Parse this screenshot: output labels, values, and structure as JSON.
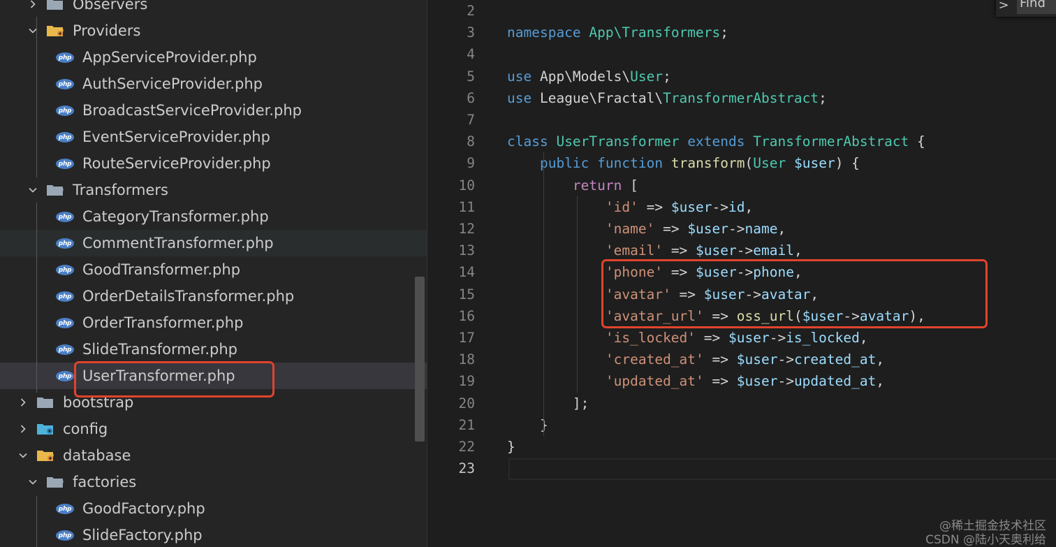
{
  "sidebar": {
    "items": [
      {
        "label": "Observers",
        "type": "folder",
        "state": "collapsed"
      },
      {
        "label": "Providers",
        "type": "folder-special",
        "state": "expanded"
      },
      {
        "label": "AppServiceProvider.php",
        "type": "php"
      },
      {
        "label": "AuthServiceProvider.php",
        "type": "php"
      },
      {
        "label": "BroadcastServiceProvider.php",
        "type": "php"
      },
      {
        "label": "EventServiceProvider.php",
        "type": "php"
      },
      {
        "label": "RouteServiceProvider.php",
        "type": "php"
      },
      {
        "label": "Transformers",
        "type": "folder",
        "state": "expanded"
      },
      {
        "label": "CategoryTransformer.php",
        "type": "php"
      },
      {
        "label": "CommentTransformer.php",
        "type": "php"
      },
      {
        "label": "GoodTransformer.php",
        "type": "php"
      },
      {
        "label": "OrderDetailsTransformer.php",
        "type": "php"
      },
      {
        "label": "OrderTransformer.php",
        "type": "php"
      },
      {
        "label": "SlideTransformer.php",
        "type": "php"
      },
      {
        "label": "UserTransformer.php",
        "type": "php",
        "selected": true
      },
      {
        "label": "bootstrap",
        "type": "folder",
        "state": "collapsed"
      },
      {
        "label": "config",
        "type": "folder-config",
        "state": "collapsed"
      },
      {
        "label": "database",
        "type": "folder-special",
        "state": "expanded"
      },
      {
        "label": "factories",
        "type": "folder",
        "state": "expanded"
      },
      {
        "label": "GoodFactory.php",
        "type": "php"
      },
      {
        "label": "SlideFactory.php",
        "type": "php"
      }
    ],
    "php_icon_text": "php"
  },
  "editor": {
    "active_line": 23,
    "lines": [
      {
        "n": "2",
        "t": []
      },
      {
        "n": "3",
        "t": [
          [
            "kw",
            "namespace"
          ],
          [
            "",
            " "
          ],
          [
            "ns",
            "App\\Transformers"
          ],
          [
            "",
            ";"
          ]
        ]
      },
      {
        "n": "4",
        "t": []
      },
      {
        "n": "5",
        "t": [
          [
            "kw",
            "use"
          ],
          [
            "",
            " App\\Models\\"
          ],
          [
            "cls",
            "User"
          ],
          [
            "",
            ";"
          ]
        ]
      },
      {
        "n": "6",
        "t": [
          [
            "kw",
            "use"
          ],
          [
            "",
            " League\\Fractal\\"
          ],
          [
            "cls",
            "TransformerAbstract"
          ],
          [
            "",
            ";"
          ]
        ]
      },
      {
        "n": "7",
        "t": []
      },
      {
        "n": "8",
        "t": [
          [
            "kw",
            "class"
          ],
          [
            "",
            " "
          ],
          [
            "cls",
            "UserTransformer"
          ],
          [
            "",
            " "
          ],
          [
            "kw",
            "extends"
          ],
          [
            "",
            " "
          ],
          [
            "cls",
            "TransformerAbstract"
          ],
          [
            "",
            " {"
          ]
        ]
      },
      {
        "n": "9",
        "t": [
          [
            "",
            "    "
          ],
          [
            "kw",
            "public"
          ],
          [
            "",
            " "
          ],
          [
            "kw",
            "function"
          ],
          [
            "",
            " "
          ],
          [
            "fn",
            "transform"
          ],
          [
            "",
            "("
          ],
          [
            "cls",
            "User"
          ],
          [
            "",
            " "
          ],
          [
            "var",
            "$user"
          ],
          [
            "",
            ") {"
          ]
        ]
      },
      {
        "n": "10",
        "t": [
          [
            "",
            "        "
          ],
          [
            "ctl",
            "return"
          ],
          [
            "",
            " ["
          ]
        ]
      },
      {
        "n": "11",
        "t": [
          [
            "",
            "            "
          ],
          [
            "str",
            "'id'"
          ],
          [
            "",
            " => "
          ],
          [
            "var",
            "$user"
          ],
          [
            "",
            "->"
          ],
          [
            "var",
            "id"
          ],
          [
            "",
            ","
          ]
        ]
      },
      {
        "n": "12",
        "t": [
          [
            "",
            "            "
          ],
          [
            "str",
            "'name'"
          ],
          [
            "",
            " => "
          ],
          [
            "var",
            "$user"
          ],
          [
            "",
            "->"
          ],
          [
            "var",
            "name"
          ],
          [
            "",
            ","
          ]
        ]
      },
      {
        "n": "13",
        "t": [
          [
            "",
            "            "
          ],
          [
            "str",
            "'email'"
          ],
          [
            "",
            " => "
          ],
          [
            "var",
            "$user"
          ],
          [
            "",
            "->"
          ],
          [
            "var",
            "email"
          ],
          [
            "",
            ","
          ]
        ]
      },
      {
        "n": "14",
        "t": [
          [
            "",
            "            "
          ],
          [
            "str",
            "'phone'"
          ],
          [
            "",
            " => "
          ],
          [
            "var",
            "$user"
          ],
          [
            "",
            "->"
          ],
          [
            "var",
            "phone"
          ],
          [
            "",
            ","
          ]
        ]
      },
      {
        "n": "15",
        "t": [
          [
            "",
            "            "
          ],
          [
            "str",
            "'avatar'"
          ],
          [
            "",
            " => "
          ],
          [
            "var",
            "$user"
          ],
          [
            "",
            "->"
          ],
          [
            "var",
            "avatar"
          ],
          [
            "",
            ","
          ]
        ]
      },
      {
        "n": "16",
        "t": [
          [
            "",
            "            "
          ],
          [
            "str",
            "'avatar_url'"
          ],
          [
            "",
            " => "
          ],
          [
            "fn",
            "oss_url"
          ],
          [
            "",
            "("
          ],
          [
            "var",
            "$user"
          ],
          [
            "",
            "->"
          ],
          [
            "var",
            "avatar"
          ],
          [
            "",
            "),"
          ]
        ]
      },
      {
        "n": "17",
        "t": [
          [
            "",
            "            "
          ],
          [
            "str",
            "'is_locked'"
          ],
          [
            "",
            " => "
          ],
          [
            "var",
            "$user"
          ],
          [
            "",
            "->"
          ],
          [
            "var",
            "is_locked"
          ],
          [
            "",
            ","
          ]
        ]
      },
      {
        "n": "18",
        "t": [
          [
            "",
            "            "
          ],
          [
            "str",
            "'created_at'"
          ],
          [
            "",
            " => "
          ],
          [
            "var",
            "$user"
          ],
          [
            "",
            "->"
          ],
          [
            "var",
            "created_at"
          ],
          [
            "",
            ","
          ]
        ]
      },
      {
        "n": "19",
        "t": [
          [
            "",
            "            "
          ],
          [
            "str",
            "'updated_at'"
          ],
          [
            "",
            " => "
          ],
          [
            "var",
            "$user"
          ],
          [
            "",
            "->"
          ],
          [
            "var",
            "updated_at"
          ],
          [
            "",
            ","
          ]
        ]
      },
      {
        "n": "20",
        "t": [
          [
            "",
            "        ];"
          ]
        ]
      },
      {
        "n": "21",
        "t": [
          [
            "",
            "    }"
          ]
        ]
      },
      {
        "n": "22",
        "t": [
          [
            "",
            "}"
          ]
        ]
      },
      {
        "n": "23",
        "t": []
      }
    ]
  },
  "find_widget": {
    "toggle": ">",
    "input_value": "Find"
  },
  "watermark": {
    "line1": "@稀土掘金技术社区",
    "line2": "CSDN @陆小天奥利给"
  },
  "colors": {
    "annotation": "#e0442c",
    "php_icon": "#4b7fc4"
  }
}
